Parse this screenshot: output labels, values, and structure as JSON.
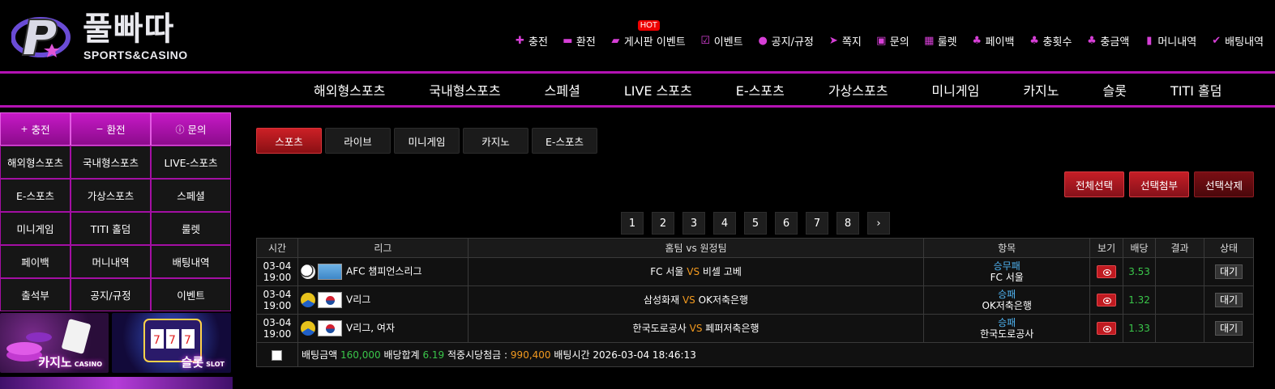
{
  "logo": {
    "brand": "풀빠따",
    "tagline": "SPORTS&CASINO"
  },
  "topnav": [
    {
      "label": "충전",
      "icon": "plus-icon"
    },
    {
      "label": "환전",
      "icon": "minus-icon"
    },
    {
      "label": "게시판 이벤트",
      "icon": "board-icon",
      "badge": "HOT"
    },
    {
      "label": "이벤트",
      "icon": "calendar-icon"
    },
    {
      "label": "공지/규정",
      "icon": "info-icon"
    },
    {
      "label": "쪽지",
      "icon": "paper-plane-icon"
    },
    {
      "label": "문의",
      "icon": "edit-icon"
    },
    {
      "label": "룰렛",
      "icon": "gift-icon"
    },
    {
      "label": "페이백",
      "icon": "hand-coin-icon"
    },
    {
      "label": "충횟수",
      "icon": "hand-coin-icon"
    },
    {
      "label": "충금액",
      "icon": "hand-coin-icon"
    },
    {
      "label": "머니내역",
      "icon": "clipboard-icon"
    },
    {
      "label": "배팅내역",
      "icon": "check-icon"
    }
  ],
  "mainmenu": [
    "해외형스포츠",
    "국내형스포츠",
    "스페셜",
    "LIVE 스포츠",
    "E-스포츠",
    "가상스포츠",
    "미니게임",
    "카지노",
    "슬롯",
    "TITI 홀덤"
  ],
  "sidebar": {
    "top": [
      {
        "label": "충전",
        "icon": "plus-icon",
        "glyph": "+"
      },
      {
        "label": "환전",
        "icon": "minus-icon",
        "glyph": "−"
      },
      {
        "label": "문의",
        "icon": "info-icon",
        "glyph": "ⓘ"
      }
    ],
    "items": [
      "해외형스포츠",
      "국내형스포츠",
      "LIVE-스포츠",
      "E-스포츠",
      "가상스포츠",
      "스페셜",
      "미니게임",
      "TITI 홀덤",
      "룰렛",
      "페이백",
      "머니내역",
      "배팅내역",
      "출석부",
      "공지/규정",
      "이벤트"
    ],
    "banners": [
      {
        "label": "카지노",
        "sub": "CASINO"
      },
      {
        "label": "슬롯",
        "sub": "SLOT"
      }
    ]
  },
  "tabs": [
    "스포츠",
    "라이브",
    "미니게임",
    "카지노",
    "E-스포츠"
  ],
  "actions": [
    "전체선택",
    "선택첨부",
    "선택삭제"
  ],
  "pages": [
    "1",
    "2",
    "3",
    "4",
    "5",
    "6",
    "7",
    "8"
  ],
  "table": {
    "headers": [
      "시간",
      "리그",
      "홈팀 vs 원정팀",
      "항목",
      "보기",
      "배당",
      "결과",
      "상태"
    ],
    "vs": "VS",
    "rows": [
      {
        "date": "03-04",
        "time": "19:00",
        "sport": "soccer",
        "flag": "world",
        "league": "AFC 챔피언스리그",
        "home": "FC 서울",
        "away": "비셀 고베",
        "market": "승무패",
        "pick": "FC 서울",
        "odds": "3.53",
        "result": "",
        "status": "대기"
      },
      {
        "date": "03-04",
        "time": "19:00",
        "sport": "volleyball",
        "flag": "korea",
        "league": "V리그",
        "home": "삼성화재",
        "away": "OK저축은행",
        "market": "승패",
        "pick": "OK저축은행",
        "odds": "1.32",
        "result": "",
        "status": "대기"
      },
      {
        "date": "03-04",
        "time": "19:00",
        "sport": "volleyball",
        "flag": "korea",
        "league": "V리그, 여자",
        "home": "한국도로공사",
        "away": "페퍼저축은행",
        "market": "승패",
        "pick": "한국도로공사",
        "odds": "1.33",
        "result": "",
        "status": "대기"
      }
    ],
    "summary": {
      "bet_label": "배팅금액",
      "bet": "160,000",
      "odds_label": "배당합계",
      "odds": "6.19",
      "win_label": "적중시당첨금 :",
      "win": "990,400",
      "time_label": "배팅시간",
      "time": "2026-03-04 18:46:13"
    }
  }
}
